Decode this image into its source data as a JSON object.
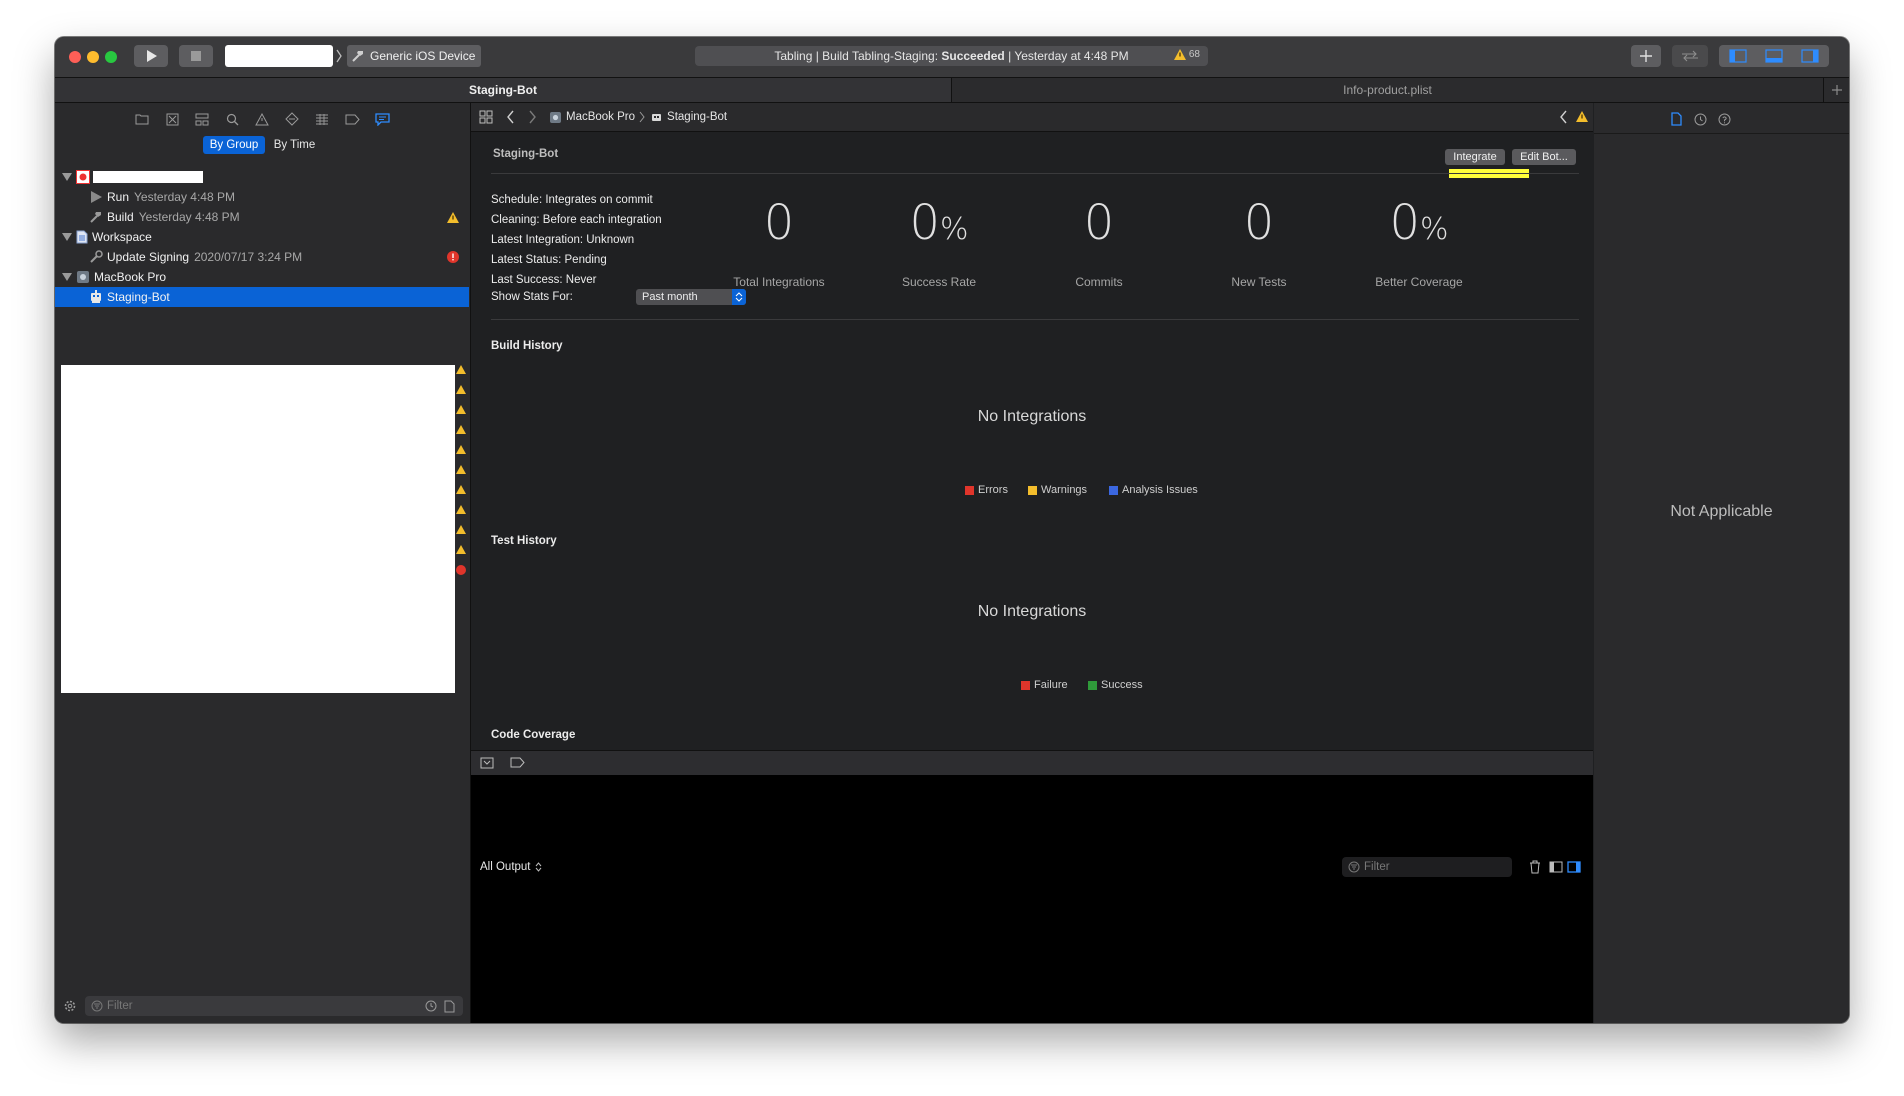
{
  "toolbar": {
    "scheme_name": "",
    "device": "Generic iOS Device",
    "activity": {
      "prefix": "Tabling | Build Tabling-Staging: ",
      "status": "Succeeded",
      "suffix": " | Yesterday at 4:48 PM",
      "warning_count": "68"
    }
  },
  "tabs": [
    {
      "label": "Staging-Bot",
      "active": true
    },
    {
      "label": "Info-product.plist",
      "active": false
    }
  ],
  "navigator": {
    "segments": {
      "by_group": "By Group",
      "by_time": "By Time"
    },
    "tree": [
      {
        "label": "",
        "sub": "",
        "level": 0
      },
      {
        "label": "Run",
        "sub": "Yesterday 4:48 PM",
        "level": 1
      },
      {
        "label": "Build",
        "sub": "Yesterday 4:48 PM",
        "level": 1,
        "badge": "warning"
      },
      {
        "label": "Workspace",
        "sub": "",
        "level": 0
      },
      {
        "label": "Update Signing",
        "sub": "2020/07/17 3:24 PM",
        "level": 1,
        "badge": "error"
      },
      {
        "label": "MacBook Pro",
        "sub": "",
        "level": 0
      },
      {
        "label": "Staging-Bot",
        "sub": "",
        "level": 1,
        "selected": true
      }
    ],
    "filter_placeholder": "Filter"
  },
  "jumpbar": {
    "crumbs": [
      "MacBook Pro",
      "Staging-Bot"
    ]
  },
  "bot": {
    "title": "Staging-Bot",
    "integrate_label": "Integrate",
    "edit_label": "Edit Bot...",
    "info": [
      "Schedule: Integrates on commit",
      "Cleaning: Before each integration",
      "Latest Integration: Unknown",
      "Latest Status: Pending",
      "Last Success: Never"
    ],
    "stats": [
      {
        "value": "0",
        "suffix": "",
        "label": "Total Integrations"
      },
      {
        "value": "0",
        "suffix": "%",
        "label": "Success Rate"
      },
      {
        "value": "0",
        "suffix": "",
        "label": "Commits"
      },
      {
        "value": "0",
        "suffix": "",
        "label": "New Tests"
      },
      {
        "value": "0",
        "suffix": "%",
        "label": "Better Coverage"
      }
    ],
    "show_stats_label": "Show Stats For:",
    "show_stats_value": "Past month",
    "build_history": {
      "title": "Build History",
      "empty": "No Integrations",
      "legend": [
        {
          "label": "Errors",
          "color": "#e0352b"
        },
        {
          "label": "Warnings",
          "color": "#f3bd2c"
        },
        {
          "label": "Analysis Issues",
          "color": "#3b67e0"
        }
      ]
    },
    "test_history": {
      "title": "Test History",
      "empty": "No Integrations",
      "legend": [
        {
          "label": "Failure",
          "color": "#e0352b"
        },
        {
          "label": "Success",
          "color": "#2f9a3a"
        }
      ]
    },
    "code_coverage": {
      "title": "Code Coverage"
    }
  },
  "debug": {
    "output_selector": "All Output",
    "filter_placeholder": "Filter"
  },
  "inspector": {
    "empty_text": "Not Applicable"
  },
  "colors": {
    "accent": "#0a63d6",
    "highlight": "#ffff3a",
    "warning": "#f3bd2c",
    "error": "#e0352b"
  }
}
